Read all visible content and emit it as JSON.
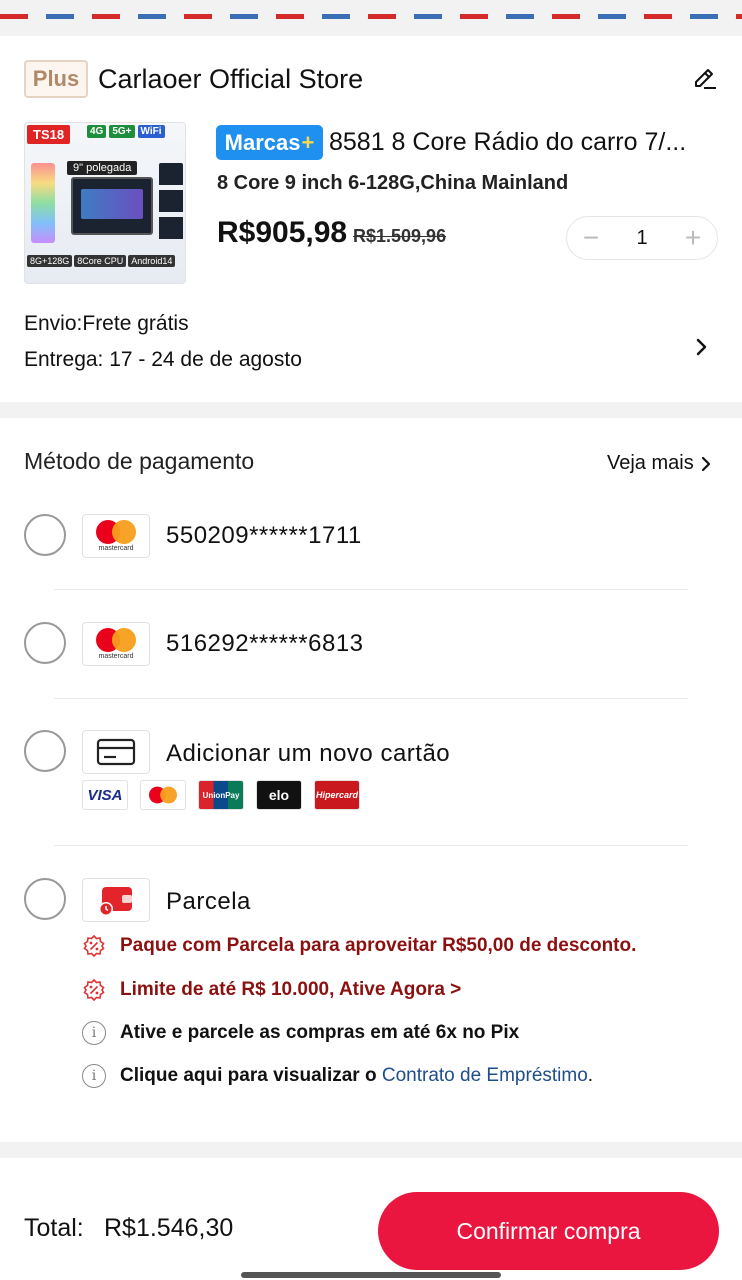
{
  "store": {
    "plus_badge": "Plus",
    "name": "Carlaoer Official Store"
  },
  "product": {
    "image_badge": "TS18",
    "image_chips": [
      "4G",
      "5G+",
      "WiFi"
    ],
    "image_screen_label": "9\" polegada",
    "image_specs": [
      "8G+128G",
      "8Core CPU",
      "Android14"
    ],
    "brand_tag": "Marcas",
    "brand_tag_plus": "+",
    "title": "8581 8 Core Rádio do carro 7/...",
    "variant": "8 Core 9 inch 6-128G,China Mainland",
    "price": "R$905,98",
    "price_old": "R$1.509,96",
    "quantity": "1"
  },
  "shipping": {
    "envio": "Envio:Frete grátis",
    "entrega": "Entrega: 17 - 24 de de agosto"
  },
  "payment": {
    "title": "Método de pagamento",
    "see_more": "Veja mais",
    "cards": [
      {
        "number": "550209******1711",
        "brand": "mastercard"
      },
      {
        "number": "516292******6813",
        "brand": "mastercard"
      }
    ],
    "add_card_label": "Adicionar um novo cartão",
    "brands": [
      "VISA",
      "mastercard",
      "UnionPay",
      "elo",
      "Hipercard"
    ],
    "parcela_label": "Parcela",
    "parcela_lines": [
      "Paque com Parcela para aproveitar R$50,00 de desconto.",
      "Limite de até R$ 10.000, Ative Agora >",
      "Ative e parcele as compras em até 6x no Pix"
    ],
    "contract_prefix": "Clique aqui para visualizar o",
    "contract_link": "Contrato de Empréstimo",
    "contract_suffix": "."
  },
  "footer": {
    "total_label": "Total:",
    "total_value": "R$1.546,30",
    "confirm_label": "Confirmar compra"
  },
  "colors": {
    "accent": "#ea1640",
    "brand_tag": "#1f8ff0",
    "link": "#1e4e8c"
  }
}
